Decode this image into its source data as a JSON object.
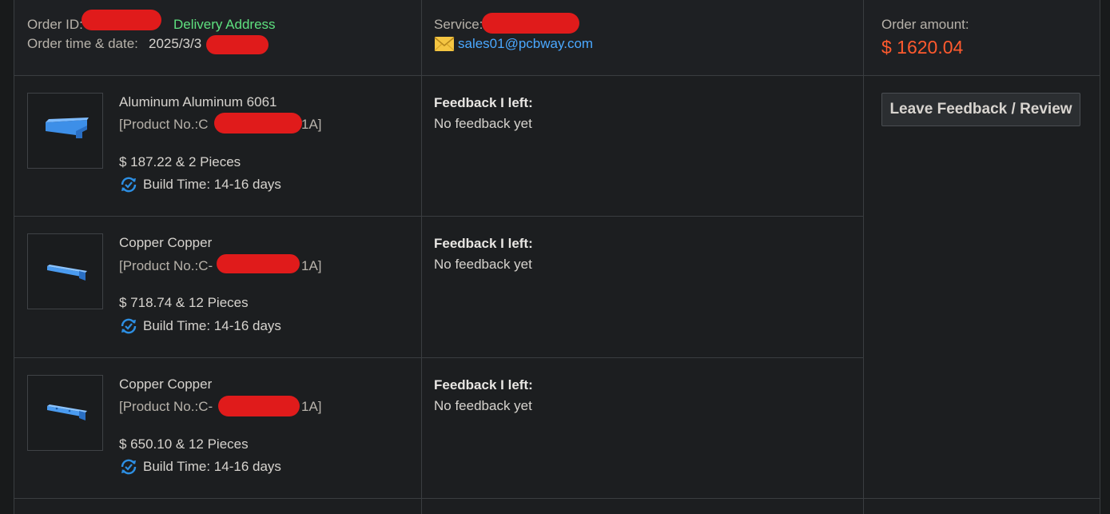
{
  "header": {
    "order_id_label": "Order ID:",
    "delivery_address": "Delivery Address",
    "order_time_label": "Order time & date:",
    "order_date": "2025/3/3",
    "service_label": "Service:",
    "email": "sales01@pcbway.com",
    "order_amount_label": "Order amount:",
    "order_amount": "$ 1620.04"
  },
  "items": [
    {
      "name": "Aluminum Aluminum 6061",
      "product_prefix": "[Product No.:C",
      "product_suffix": "1A]",
      "price_qty": "$ 187.22 & 2 Pieces",
      "build_time": "Build Time: 14-16 days",
      "feedback_label": "Feedback I left:",
      "feedback_value": "No feedback yet"
    },
    {
      "name": "Copper Copper",
      "product_prefix": "[Product No.:C-",
      "product_suffix": "1A]",
      "price_qty": "$ 718.74 & 12 Pieces",
      "build_time": "Build Time: 14-16 days",
      "feedback_label": "Feedback I left:",
      "feedback_value": "No feedback yet"
    },
    {
      "name": "Copper Copper",
      "product_prefix": "[Product No.:C-",
      "product_suffix": "1A]",
      "price_qty": "$ 650.10 & 12 Pieces",
      "build_time": "Build Time: 14-16 days",
      "feedback_label": "Feedback I left:",
      "feedback_value": "No feedback yet"
    }
  ],
  "actions": {
    "leave_feedback": "Leave Feedback / Review"
  },
  "colors": {
    "accent_orange": "#ff5a2e",
    "link_blue": "#4aa8ff",
    "address_green": "#5ee07f",
    "redaction_red": "#e01b1b"
  }
}
